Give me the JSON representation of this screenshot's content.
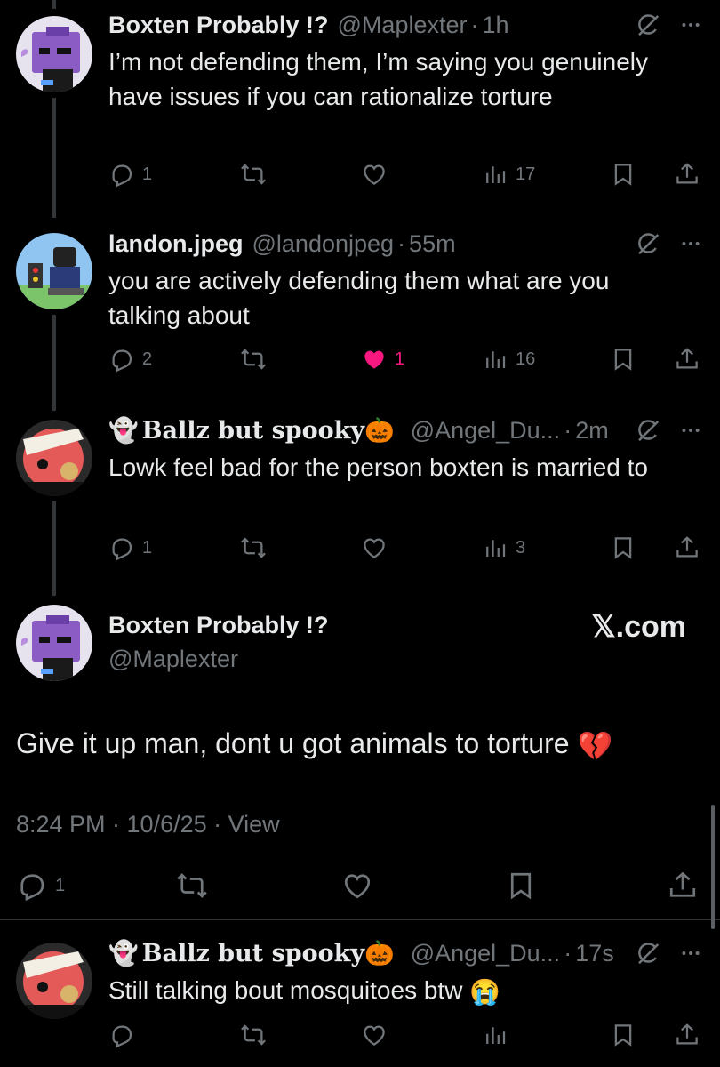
{
  "replies_above": [
    {
      "name": "Boxten Probably !?",
      "handle": "@Maplexter",
      "time": "1h",
      "text": "I’m not defending them, I’m saying you genuinely have issues if you can rationalize torture",
      "replies": "1",
      "retweets": "",
      "likes": "",
      "views": "17",
      "liked": false
    },
    {
      "name": "landon.jpeg",
      "handle": "@landonjpeg",
      "time": "55m",
      "text": "you are actively defending them what are you talking about",
      "replies": "2",
      "retweets": "",
      "likes": "1",
      "views": "16",
      "liked": true
    },
    {
      "name": "Ballz but spooky",
      "handle": "@Angel_Du...",
      "time": "2m",
      "text": "Lowk feel bad for the person boxten is married to",
      "replies": "1",
      "retweets": "",
      "likes": "",
      "views": "3",
      "liked": false
    }
  ],
  "main_post": {
    "name": "Boxten Probably !?",
    "handle": "@Maplexter",
    "watermark": "𝕏.com",
    "text": "Give it up man, dont u got animals to torture",
    "text_emoji": "💔",
    "timestamp": "8:24 PM · 10/6/25 · View",
    "replies": "1"
  },
  "reply_below": {
    "name": "Ballz but spooky",
    "handle": "@Angel_Du...",
    "time": "17s",
    "text": "Still talking bout mosquitoes btw",
    "text_emoji": "😭"
  },
  "ghost_emoji": "👻",
  "pumpkin_emoji": "🎃",
  "colors": {
    "background": "#000000",
    "text": "#e7e9ea",
    "muted": "#71767b",
    "like_pink": "#f91880",
    "divider": "#2f3336"
  }
}
